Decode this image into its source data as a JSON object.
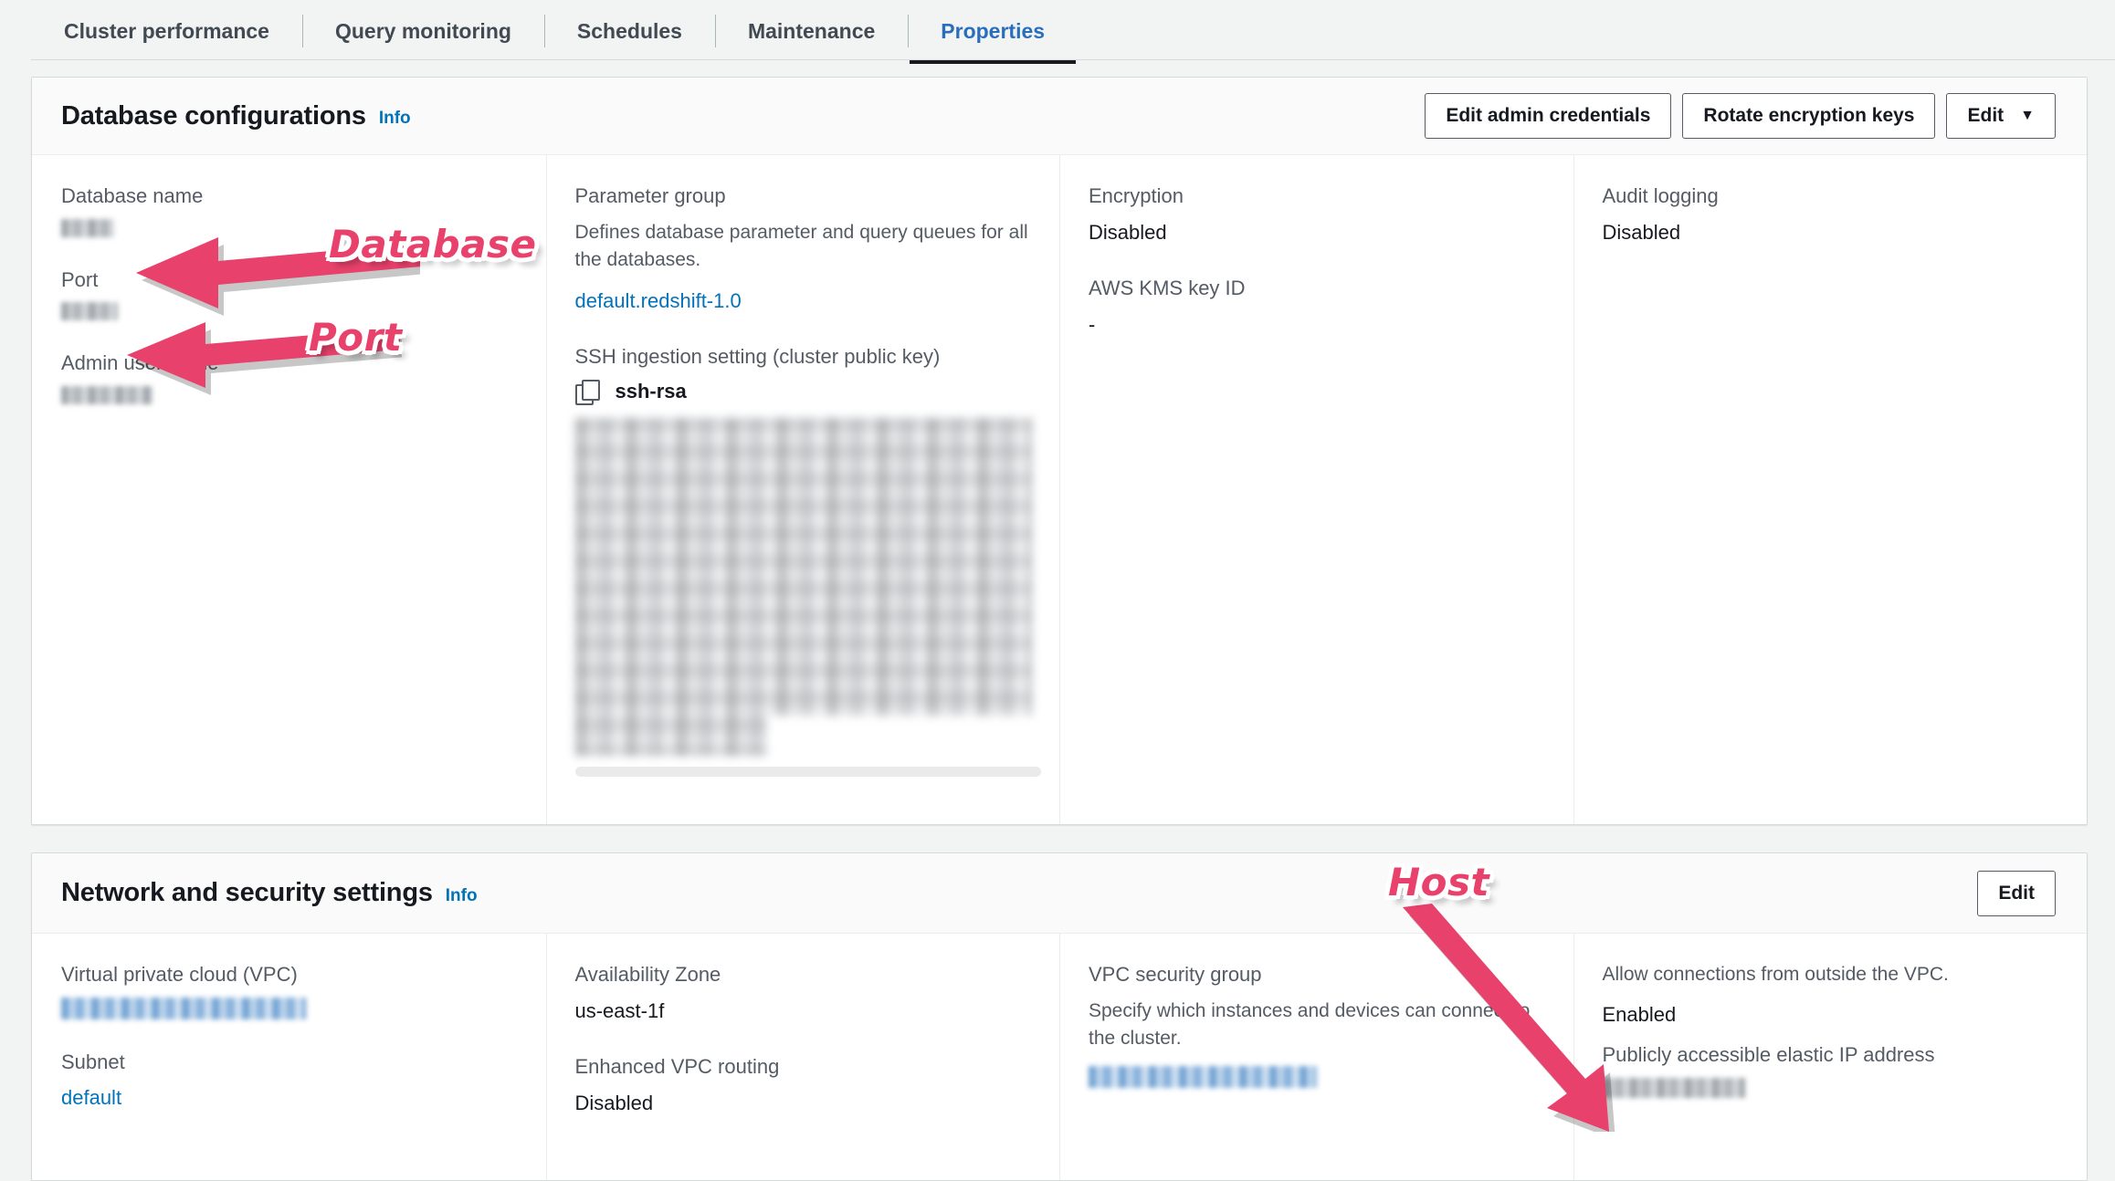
{
  "tabs": [
    {
      "label": "Cluster performance",
      "active": false
    },
    {
      "label": "Query monitoring",
      "active": false
    },
    {
      "label": "Schedules",
      "active": false
    },
    {
      "label": "Maintenance",
      "active": false
    },
    {
      "label": "Properties",
      "active": true
    }
  ],
  "database_card": {
    "title": "Database configurations",
    "info_label": "Info",
    "buttons": {
      "edit_admin_credentials": "Edit admin credentials",
      "rotate_encryption_keys": "Rotate encryption keys",
      "edit": "Edit",
      "edit_caret": "▼"
    },
    "col1": {
      "database_name_label": "Database name",
      "database_name_value": "",
      "port_label": "Port",
      "port_value": "",
      "admin_user_name_label": "Admin user name",
      "admin_user_name_value": ""
    },
    "col2": {
      "parameter_group_label": "Parameter group",
      "parameter_group_desc": "Defines database parameter and query queues for all the databases.",
      "parameter_group_value": "default.redshift-1.0",
      "ssh_label": "SSH ingestion setting (cluster public key)",
      "ssh_key_type": "ssh-rsa",
      "ssh_key_value": ""
    },
    "col3": {
      "encryption_label": "Encryption",
      "encryption_value": "Disabled",
      "kms_label": "AWS KMS key ID",
      "kms_value": "-"
    },
    "col4": {
      "audit_logging_label": "Audit logging",
      "audit_logging_value": "Disabled"
    }
  },
  "network_card": {
    "title": "Network and security settings",
    "info_label": "Info",
    "buttons": {
      "edit": "Edit"
    },
    "col1": {
      "vpc_label": "Virtual private cloud (VPC)",
      "vpc_value": "",
      "subnet_label": "Subnet",
      "subnet_value": "default"
    },
    "col2": {
      "az_label": "Availability Zone",
      "az_value": "us-east-1f",
      "enhanced_routing_label": "Enhanced VPC routing",
      "enhanced_routing_value": "Disabled"
    },
    "col3": {
      "sg_label": "VPC security group",
      "sg_desc": "Specify which instances and devices can connect to the cluster.",
      "sg_value": ""
    },
    "col4": {
      "public_desc": "Allow connections from outside the VPC.",
      "public_value": "Enabled",
      "eip_label": "Publicly accessible elastic IP address",
      "eip_value": ""
    }
  },
  "annotations": {
    "database": "Database",
    "port": "Port",
    "host": "Host",
    "color": "#e8416b"
  }
}
